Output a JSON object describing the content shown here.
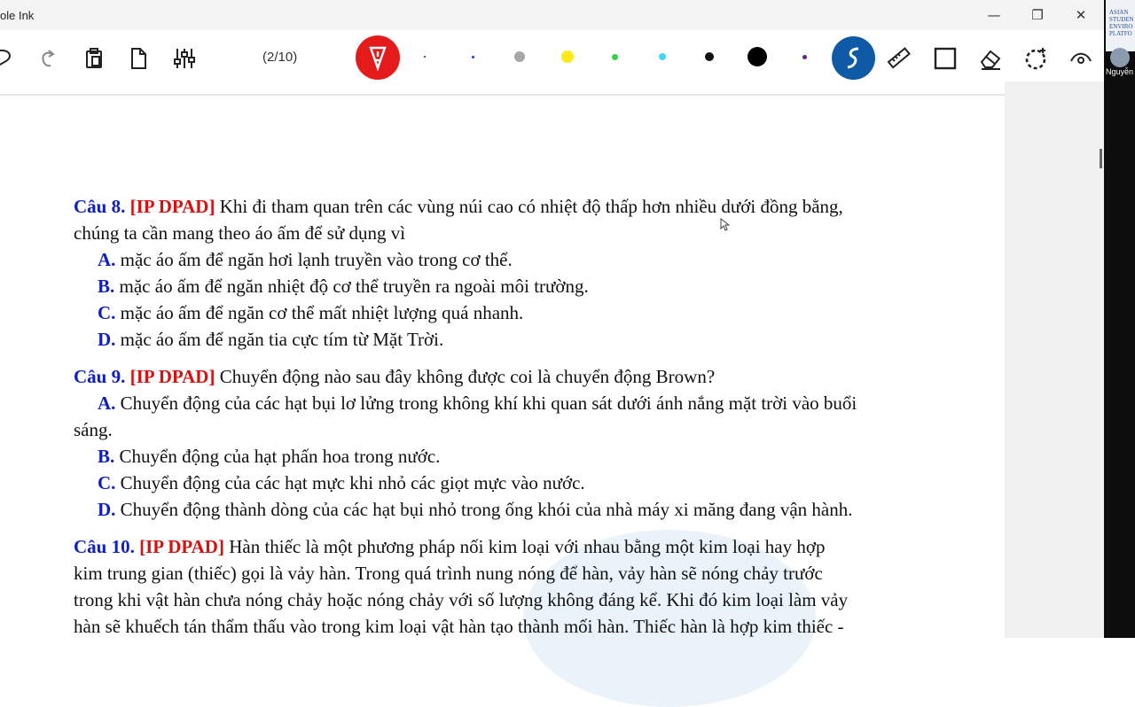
{
  "window": {
    "title": "ole Ink",
    "minimize_glyph": "—",
    "maximize_glyph": "❐",
    "close_glyph": "✕"
  },
  "toolbar": {
    "page_counter": "(2/10)",
    "tools": [
      "lasso-icon",
      "redo-icon",
      "paste-icon",
      "new-page-icon",
      "adjust-icon"
    ],
    "pen_colors": [
      {
        "color": "#222222",
        "size": 2
      },
      {
        "color": "#1a3fd6",
        "size": 3
      },
      {
        "color": "#a6a6a6",
        "size": 12
      },
      {
        "color": "#ffe81a",
        "size": 14
      },
      {
        "color": "#34d34a",
        "size": 7
      },
      {
        "color": "#3fd9f2",
        "size": 8
      },
      {
        "color": "#111111",
        "size": 10
      },
      {
        "color": "#000000",
        "size": 22
      },
      {
        "color": "#6b1e8c",
        "size": 5
      }
    ],
    "accent_red": "#e51b1b",
    "accent_blue": "#0e5aa7"
  },
  "side_video": {
    "logo_text": "ASIAN\nSTUDEN\nENVIRO\nPLATFO",
    "name": "Nguyễn"
  },
  "document": {
    "questions": [
      {
        "label": "Câu 8.",
        "tag": "[IP DPAD]",
        "stem_line1": " Khi đi tham quan trên các vùng núi cao có nhiệt độ thấp hơn nhiều dưới đồng bằng,",
        "stem_line2": "chúng ta cần mang theo áo ấm để sử dụng vì",
        "options": [
          {
            "letter": "A.",
            "text": " mặc áo ấm để ngăn hơi lạnh truyền vào trong cơ thể."
          },
          {
            "letter": "B.",
            "text": " mặc áo ấm để ngăn nhiệt độ cơ thể truyền ra ngoài môi trường."
          },
          {
            "letter": "C.",
            "text": " mặc áo ấm để ngăn cơ thể mất nhiệt lượng quá nhanh."
          },
          {
            "letter": "D.",
            "text": " mặc áo ấm để ngăn tia cực tím từ Mặt Trời."
          }
        ]
      },
      {
        "label": "Câu 9.",
        "tag": "[IP DPAD]",
        "stem_line1": " Chuyển động nào sau đây không được coi là chuyển động Brown?",
        "options": [
          {
            "letter": "A.",
            "text": " Chuyển động của các hạt bụi lơ lửng trong không khí khi quan sát dưới ánh nắng mặt trời vào buổi",
            "wrap": "sáng."
          },
          {
            "letter": "B.",
            "text": " Chuyển động của hạt phấn hoa trong nước."
          },
          {
            "letter": "C.",
            "text": " Chuyển động của các hạt mực khi nhỏ các giọt mực vào nước."
          },
          {
            "letter": "D.",
            "text": " Chuyển động thành dòng của các hạt bụi nhỏ trong ống khói của nhà máy xi măng đang vận hành."
          }
        ]
      },
      {
        "label": "Câu 10.",
        "tag": "[IP DPAD]",
        "stem_line1": " Hàn thiếc là một phương pháp nối kim loại với nhau bằng một kim loại hay hợp",
        "stem_line2": "kim trung gian (thiếc) gọi là vảy hàn. Trong quá trình nung nóng để hàn, vảy hàn sẽ nóng chảy trước",
        "stem_line3": "trong khi vật hàn chưa nóng chảy hoặc nóng chảy với số lượng không đáng kể. Khi đó kim loại làm vảy",
        "stem_line4": "hàn sẽ khuếch tán thẩm thấu vào trong kim loại vật hàn tạo thành mối hàn. Thiếc hàn là hợp kim thiếc -"
      }
    ]
  }
}
